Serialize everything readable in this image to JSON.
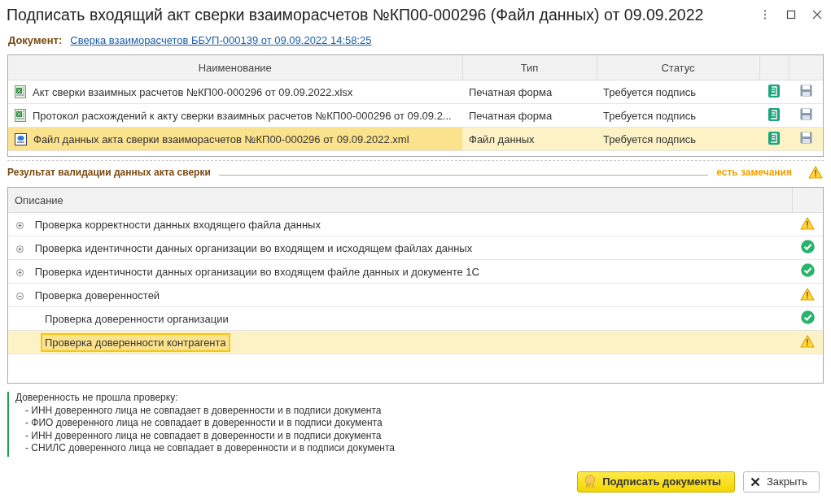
{
  "window": {
    "title": "Подписать входящий акт сверки взаиморасчетов №КП00-000296 (Файл данных) от 09.09.2022"
  },
  "document": {
    "label": "Документ:",
    "link": "Сверка взаиморасчетов ББУП-000139 от 09.09.2022 14:58:25"
  },
  "files_table": {
    "columns": [
      "Наименование",
      "Тип",
      "Статус"
    ],
    "rows": [
      {
        "kind": "spreadsheet",
        "name": "Акт сверки взаимных расчетов №КП00-000296 от 09.09.2022.xlsx",
        "type": "Печатная форма",
        "status": "Требуется подпись",
        "selected": false
      },
      {
        "kind": "spreadsheet",
        "name": "Протокол расхождений к акту сверки взаимных расчетов №КП00-000296 от 09.09.2...",
        "type": "Печатная форма",
        "status": "Требуется подпись",
        "selected": false
      },
      {
        "kind": "data",
        "name": "Файл данных акта сверки взаиморасчетов №КП00-000296 от 09.09.2022.xml",
        "type": "Файл данных",
        "status": "Требуется подпись",
        "selected": true
      }
    ]
  },
  "validation": {
    "title": "Результат валидации данных акта сверки",
    "result": {
      "text": "есть замечания",
      "kind": "warning"
    },
    "column": "Описание",
    "items": [
      {
        "text": "Проверка корректности данных входящего файла данных",
        "kind": "warning",
        "expanded": false,
        "selected": false
      },
      {
        "text": "Проверка идентичности данных организации во входящем и исходящем файлах данных",
        "kind": "ok",
        "expanded": false,
        "selected": false
      },
      {
        "text": "Проверка идентичности данных организации во входящем файле данных и документе 1С",
        "kind": "ok",
        "expanded": false,
        "selected": false
      },
      {
        "text": "Проверка доверенностей",
        "kind": "warning",
        "expanded": true,
        "selected": false,
        "children": [
          {
            "text": "Проверка доверенности организации",
            "kind": "ok",
            "selected": false
          },
          {
            "text": "Проверка доверенности контрагента",
            "kind": "warning",
            "selected": true
          }
        ]
      }
    ]
  },
  "message": {
    "heading": "Доверенность не прошла проверку:",
    "lines": [
      "- ИНН доверенного лица не совпадает в доверенности и в подписи документа",
      "- ФИО доверенного лица не совпадает в доверенности и в подписи документа",
      "- ИНН доверенного лица не совпадает в доверенности и в подписи документа",
      "- СНИЛС доверенного лица не совпадает в доверенности и в подписи документа"
    ]
  },
  "buttons": [
    {
      "kind": "primary",
      "label": "Подписать документы"
    },
    {
      "kind": "close",
      "label": "Закрыть"
    }
  ]
}
